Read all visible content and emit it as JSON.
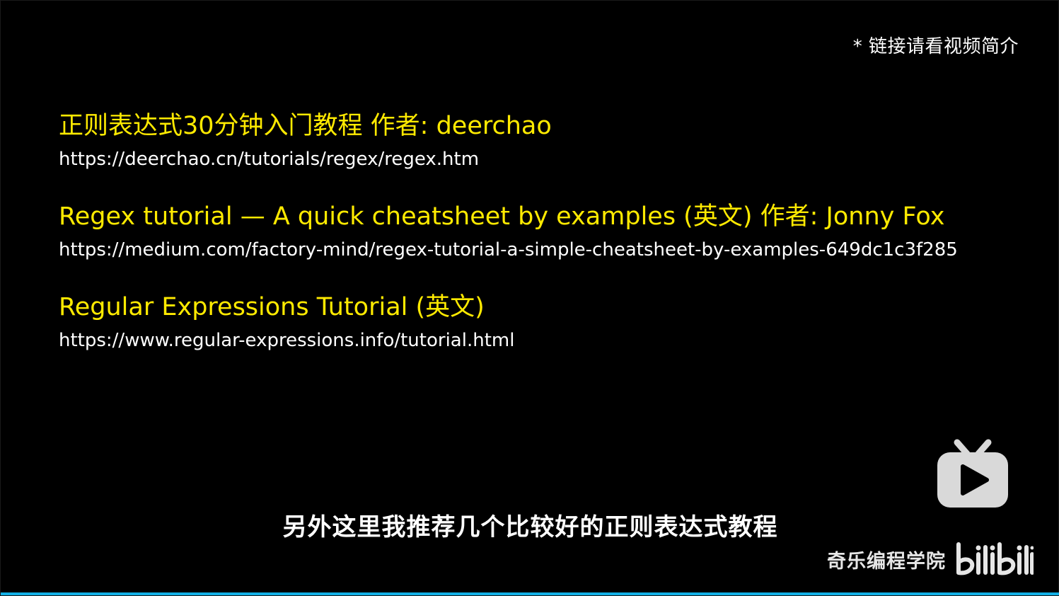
{
  "slide": {
    "note": "* 链接请看视频简介",
    "resources": [
      {
        "title": "正则表达式30分钟入门教程 作者: deerchao",
        "url": "https://deerchao.cn/tutorials/regex/regex.htm"
      },
      {
        "title": "Regex tutorial — A quick cheatsheet by examples (英文) 作者: Jonny Fox",
        "url": "https://medium.com/factory-mind/regex-tutorial-a-simple-cheatsheet-by-examples-649dc1c3f285"
      },
      {
        "title": "Regular Expressions Tutorial (英文)",
        "url": "https://www.regular-expressions.info/tutorial.html"
      }
    ]
  },
  "subtitle": "另外这里我推荐几个比较好的正则表达式教程",
  "watermark": {
    "channel": "奇乐编程学院",
    "brand_icon": "bilibili-logo-icon",
    "tv_icon": "bilibili-tv-play-icon"
  },
  "player": {
    "progress_fraction": 1.0
  },
  "colors": {
    "background": "#000000",
    "title": "#ffea00",
    "url": "#ffffff",
    "progress": "#12b0e6"
  }
}
